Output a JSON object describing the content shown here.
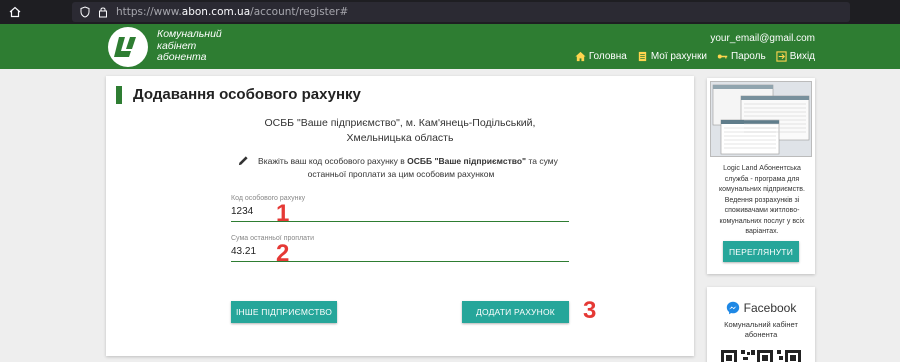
{
  "browser": {
    "url_scheme": "https://www.",
    "url_host": "abon.com.ua",
    "url_path": "/account/register#"
  },
  "header": {
    "logo_line1": "Комунальний",
    "logo_line2": "кабінет",
    "logo_line3": "абонента",
    "user_email": "your_email@gmail.com",
    "nav": [
      {
        "label": "Головна",
        "icon": "home-icon"
      },
      {
        "label": "Мої рахунки",
        "icon": "list-icon"
      },
      {
        "label": "Пароль",
        "icon": "key-icon"
      },
      {
        "label": "Вихід",
        "icon": "exit-icon"
      }
    ],
    "accent_color": "#2e7d32"
  },
  "form": {
    "title": "Додавання особового рахунку",
    "org_line1": "ОСББ \"Ваше підприємство\", м. Кам'янець-Подільський,",
    "org_line2": "Хмельницька область",
    "hint_prefix": "Вкажіть ваш код особового рахунку в",
    "hint_org": "ОСББ \"Ваше підприємство\"",
    "hint_suffix": "та суму останньої проплати за цим особовим рахунком",
    "account_label": "Код особового рахунку",
    "account_value": "1234",
    "amount_label": "Сума останньої проплати",
    "amount_value": "43.21",
    "other_button": "ІНШЕ ПІДПРИЄМСТВО",
    "add_button": "ДОДАТИ РАХУНОК",
    "button_color": "#26a69a"
  },
  "annotations": {
    "n1": "1",
    "n2": "2",
    "n3": "3"
  },
  "sidebar": {
    "promo_text": "Logic Land Абонентська служба - програма для комунальних підприємств. Ведення розрахунків зі споживачами житлово-комунальних послуг у всіх варіантах.",
    "promo_button": "ПЕРЕГЛЯНУТИ",
    "fb_title": "Facebook",
    "fb_sub": "Комунальний кабінет абонента"
  }
}
